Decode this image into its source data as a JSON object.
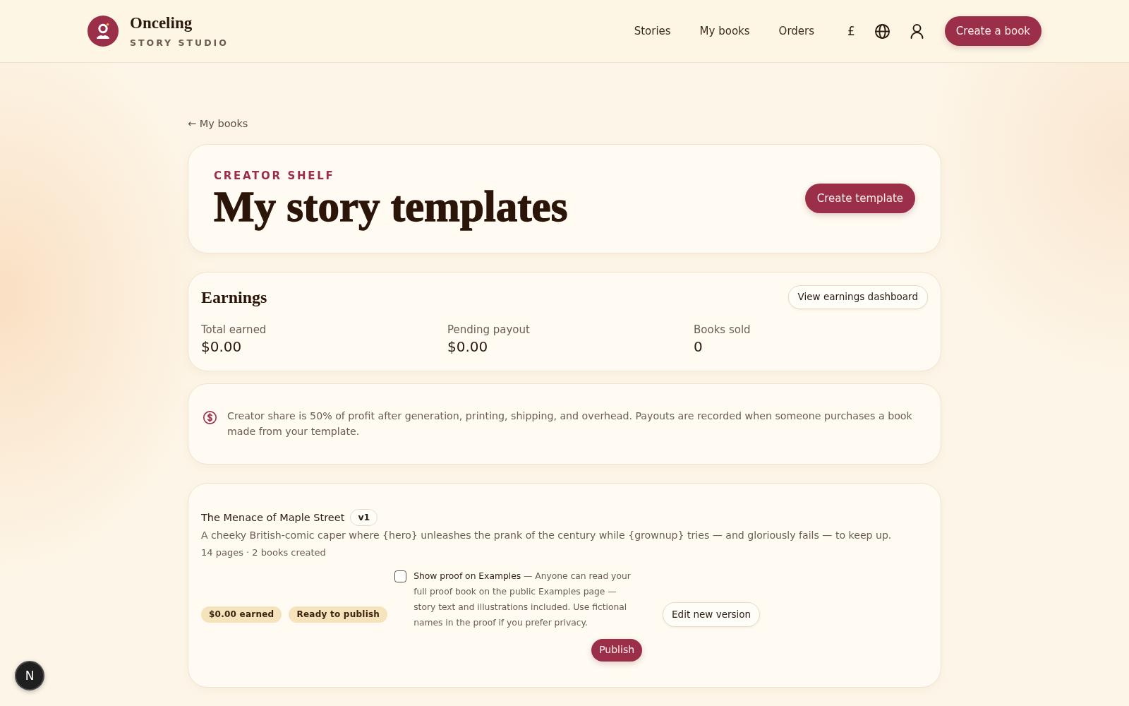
{
  "header": {
    "brand_name": "Onceling",
    "brand_tagline": "STORY STUDIO",
    "nav_links": [
      {
        "label": "Stories"
      },
      {
        "label": "My books"
      },
      {
        "label": "Orders"
      }
    ],
    "currency_button": "£",
    "cta_button": "Create a book"
  },
  "back_link": "← My books",
  "hero": {
    "eyebrow": "CREATOR SHELF",
    "title": "My story templates",
    "button": "Create template"
  },
  "earnings": {
    "title": "Earnings",
    "button": "View earnings dashboard",
    "metrics": [
      {
        "label": "Total earned",
        "value": "$0.00"
      },
      {
        "label": "Pending payout",
        "value": "$0.00"
      },
      {
        "label": "Books sold",
        "value": "0"
      }
    ]
  },
  "notice": {
    "text": "Creator share is 50% of profit after generation, printing, shipping, and overhead. Payouts are recorded when someone purchases a book made from your template."
  },
  "templates": [
    {
      "title": "The Menace of Maple Street",
      "version": "v1",
      "description": "A cheeky British-comic caper where {hero} unleashes the prank of the century while {grownup} tries — and gloriously fails — to keep up.",
      "meta": "14 pages · 2 books created",
      "badges": [
        "$0.00 earned",
        "Ready to publish"
      ],
      "proof_toggle": {
        "checked": false,
        "text": "**Show proof on Examples** — Anyone can read your full proof book on the public Examples page — story text and illustrations included. Use fictional names in the proof if you prefer privacy."
      },
      "edit_button": "Edit new version",
      "publish_button": "Publish"
    }
  ],
  "dev_indicator": {
    "label": "N"
  }
}
